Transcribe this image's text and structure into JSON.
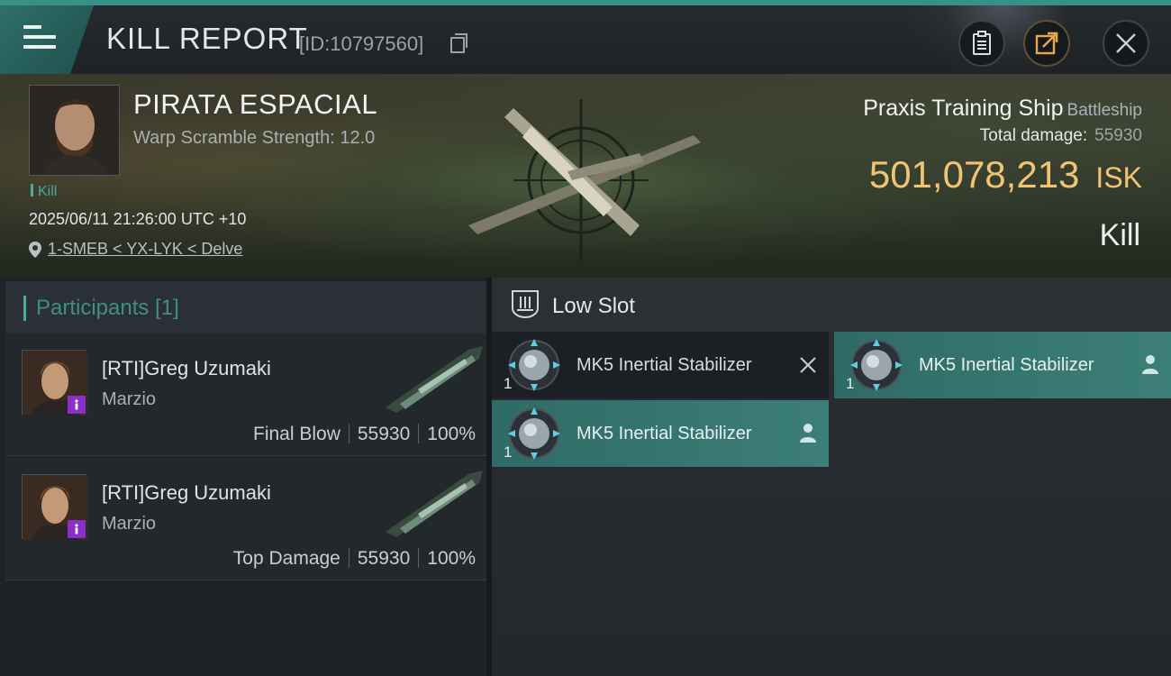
{
  "header": {
    "title": "KILL REPORT",
    "id_text": "[ID:10797560]"
  },
  "victim": {
    "name": "PIRATA ESPACIAL",
    "warp_text": "Warp Scramble Strength: 12.0",
    "tag": "Kill",
    "datetime": "2025/06/11 21:26:00 UTC +10",
    "location": "1-SMEB < YX-LYK < Delve"
  },
  "ship": {
    "name": "Praxis Training Ship",
    "class": "Battleship",
    "total_damage_label": "Total damage:",
    "total_damage": "55930",
    "isk_value": "501,078,213",
    "isk_unit": "ISK",
    "result": "Kill"
  },
  "participants": {
    "heading": "Participants [1]",
    "rows": [
      {
        "name": "[RTI]Greg Uzumaki",
        "ship": "Marzio",
        "role": "Final Blow",
        "damage": "55930",
        "percent": "100%"
      },
      {
        "name": "[RTI]Greg Uzumaki",
        "ship": "Marzio",
        "role": "Top Damage",
        "damage": "55930",
        "percent": "100%"
      }
    ]
  },
  "slots": {
    "heading": "Low Slot",
    "modules": [
      {
        "name": "MK5 Inertial Stabilizer",
        "qty": "1",
        "status": "destroyed"
      },
      {
        "name": "MK5 Inertial Stabilizer",
        "qty": "1",
        "status": "dropped"
      },
      {
        "name": "MK5 Inertial Stabilizer",
        "qty": "1",
        "status": "dropped"
      }
    ]
  },
  "colors": {
    "accent_teal": "#4aa9a0",
    "isk_gold": "#f0c474",
    "corp_purple": "#8a2fc9"
  }
}
